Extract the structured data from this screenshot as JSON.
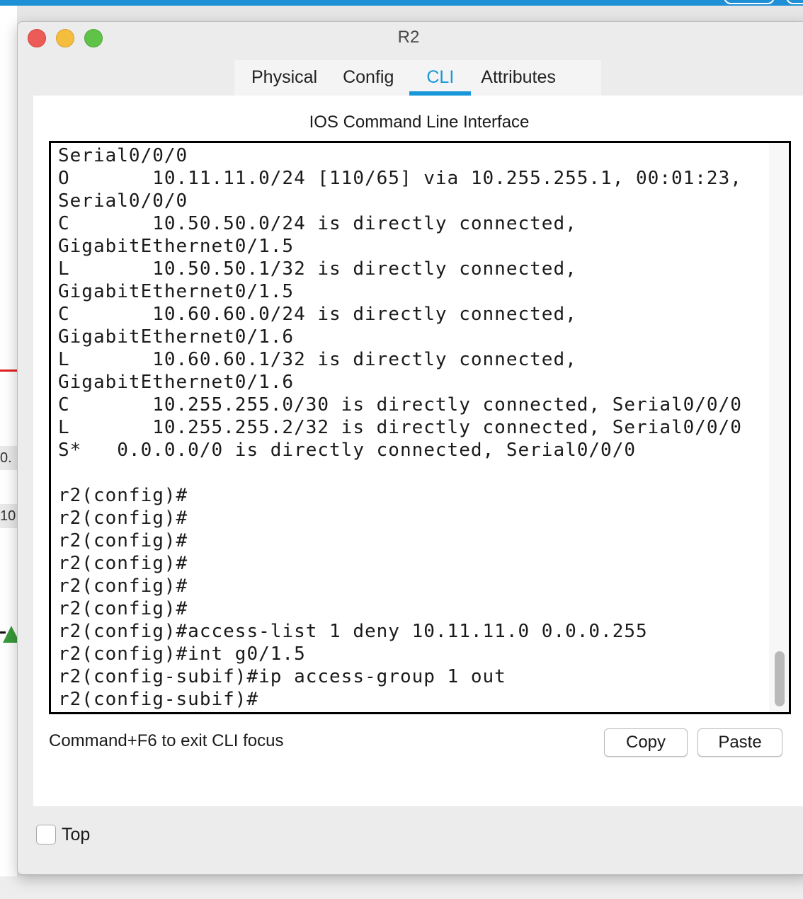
{
  "background": {
    "label_1": "0.",
    "label_2": "10"
  },
  "window": {
    "title": "R2",
    "tabs": [
      {
        "label": "Physical",
        "active": false
      },
      {
        "label": "Config",
        "active": false
      },
      {
        "label": "CLI",
        "active": true
      },
      {
        "label": "Attributes",
        "active": false
      }
    ]
  },
  "cli": {
    "title": "IOS Command Line Interface",
    "lines": [
      "Serial0/0/0",
      "O       10.11.11.0/24 [110/65] via 10.255.255.1, 00:01:23,",
      "Serial0/0/0",
      "C       10.50.50.0/24 is directly connected,",
      "GigabitEthernet0/1.5",
      "L       10.50.50.1/32 is directly connected,",
      "GigabitEthernet0/1.5",
      "C       10.60.60.0/24 is directly connected,",
      "GigabitEthernet0/1.6",
      "L       10.60.60.1/32 is directly connected,",
      "GigabitEthernet0/1.6",
      "C       10.255.255.0/30 is directly connected, Serial0/0/0",
      "L       10.255.255.2/32 is directly connected, Serial0/0/0",
      "S*   0.0.0.0/0 is directly connected, Serial0/0/0",
      "",
      "r2(config)#",
      "r2(config)#",
      "r2(config)#",
      "r2(config)#",
      "r2(config)#",
      "r2(config)#",
      "r2(config)#access-list 1 deny 10.11.11.0 0.0.0.255",
      "r2(config)#int g0/1.5",
      "r2(config-subif)#ip access-group 1 out",
      "r2(config-subif)#"
    ],
    "focus_hint": "Command+F6 to exit CLI focus",
    "copy_label": "Copy",
    "paste_label": "Paste"
  },
  "footer": {
    "top_label": "Top",
    "top_checked": false
  },
  "colors": {
    "accent": "#1898d8",
    "close": "#ec5b55",
    "minimize": "#f4bd3e",
    "maximize": "#60c349"
  }
}
